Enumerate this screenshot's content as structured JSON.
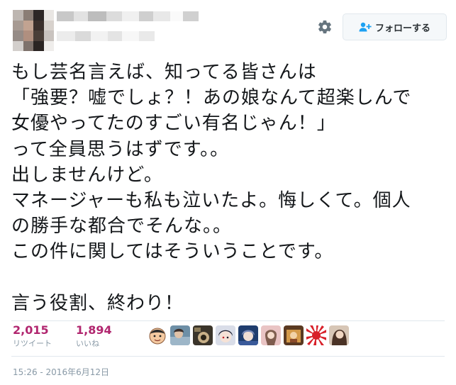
{
  "header": {
    "follow_label": "フォローする",
    "settings_icon": "gear-icon",
    "follow_icon": "person-add-icon"
  },
  "tweet": {
    "text": "もし芸名言えば、知ってる皆さんは\n「強要？嘘でしょ？！あの娘なんて超楽しんで\n女優やってたのすごい有名じゃん！」\nって全員思うはずです。。\n出しませんけど。\nマネージャーも私も泣いたよ。悔しくて。個人\nの勝手な都合でそんな。。\nこの件に関してはそういうことです。\n\n言う役割、終わり！"
  },
  "stats": {
    "retweets_count": "2,015",
    "retweets_label": "リツイート",
    "likes_count": "1,894",
    "likes_label": "いいね"
  },
  "likers": [
    {
      "icon": "cartoon-face-avatar"
    },
    {
      "icon": "photo-avatar"
    },
    {
      "icon": "photo-avatar"
    },
    {
      "icon": "anime-avatar"
    },
    {
      "icon": "anime-avatar"
    },
    {
      "icon": "photo-avatar"
    },
    {
      "icon": "photo-avatar"
    },
    {
      "icon": "rising-sun-avatar"
    },
    {
      "icon": "photo-avatar"
    }
  ],
  "timestamp": "15:26 - 2016年6月12日",
  "colors": {
    "stat_count": "#b1266f",
    "muted_text": "#8899a6",
    "divider": "#e1e8ed",
    "follow_button_bg": "#f5f8fa"
  }
}
